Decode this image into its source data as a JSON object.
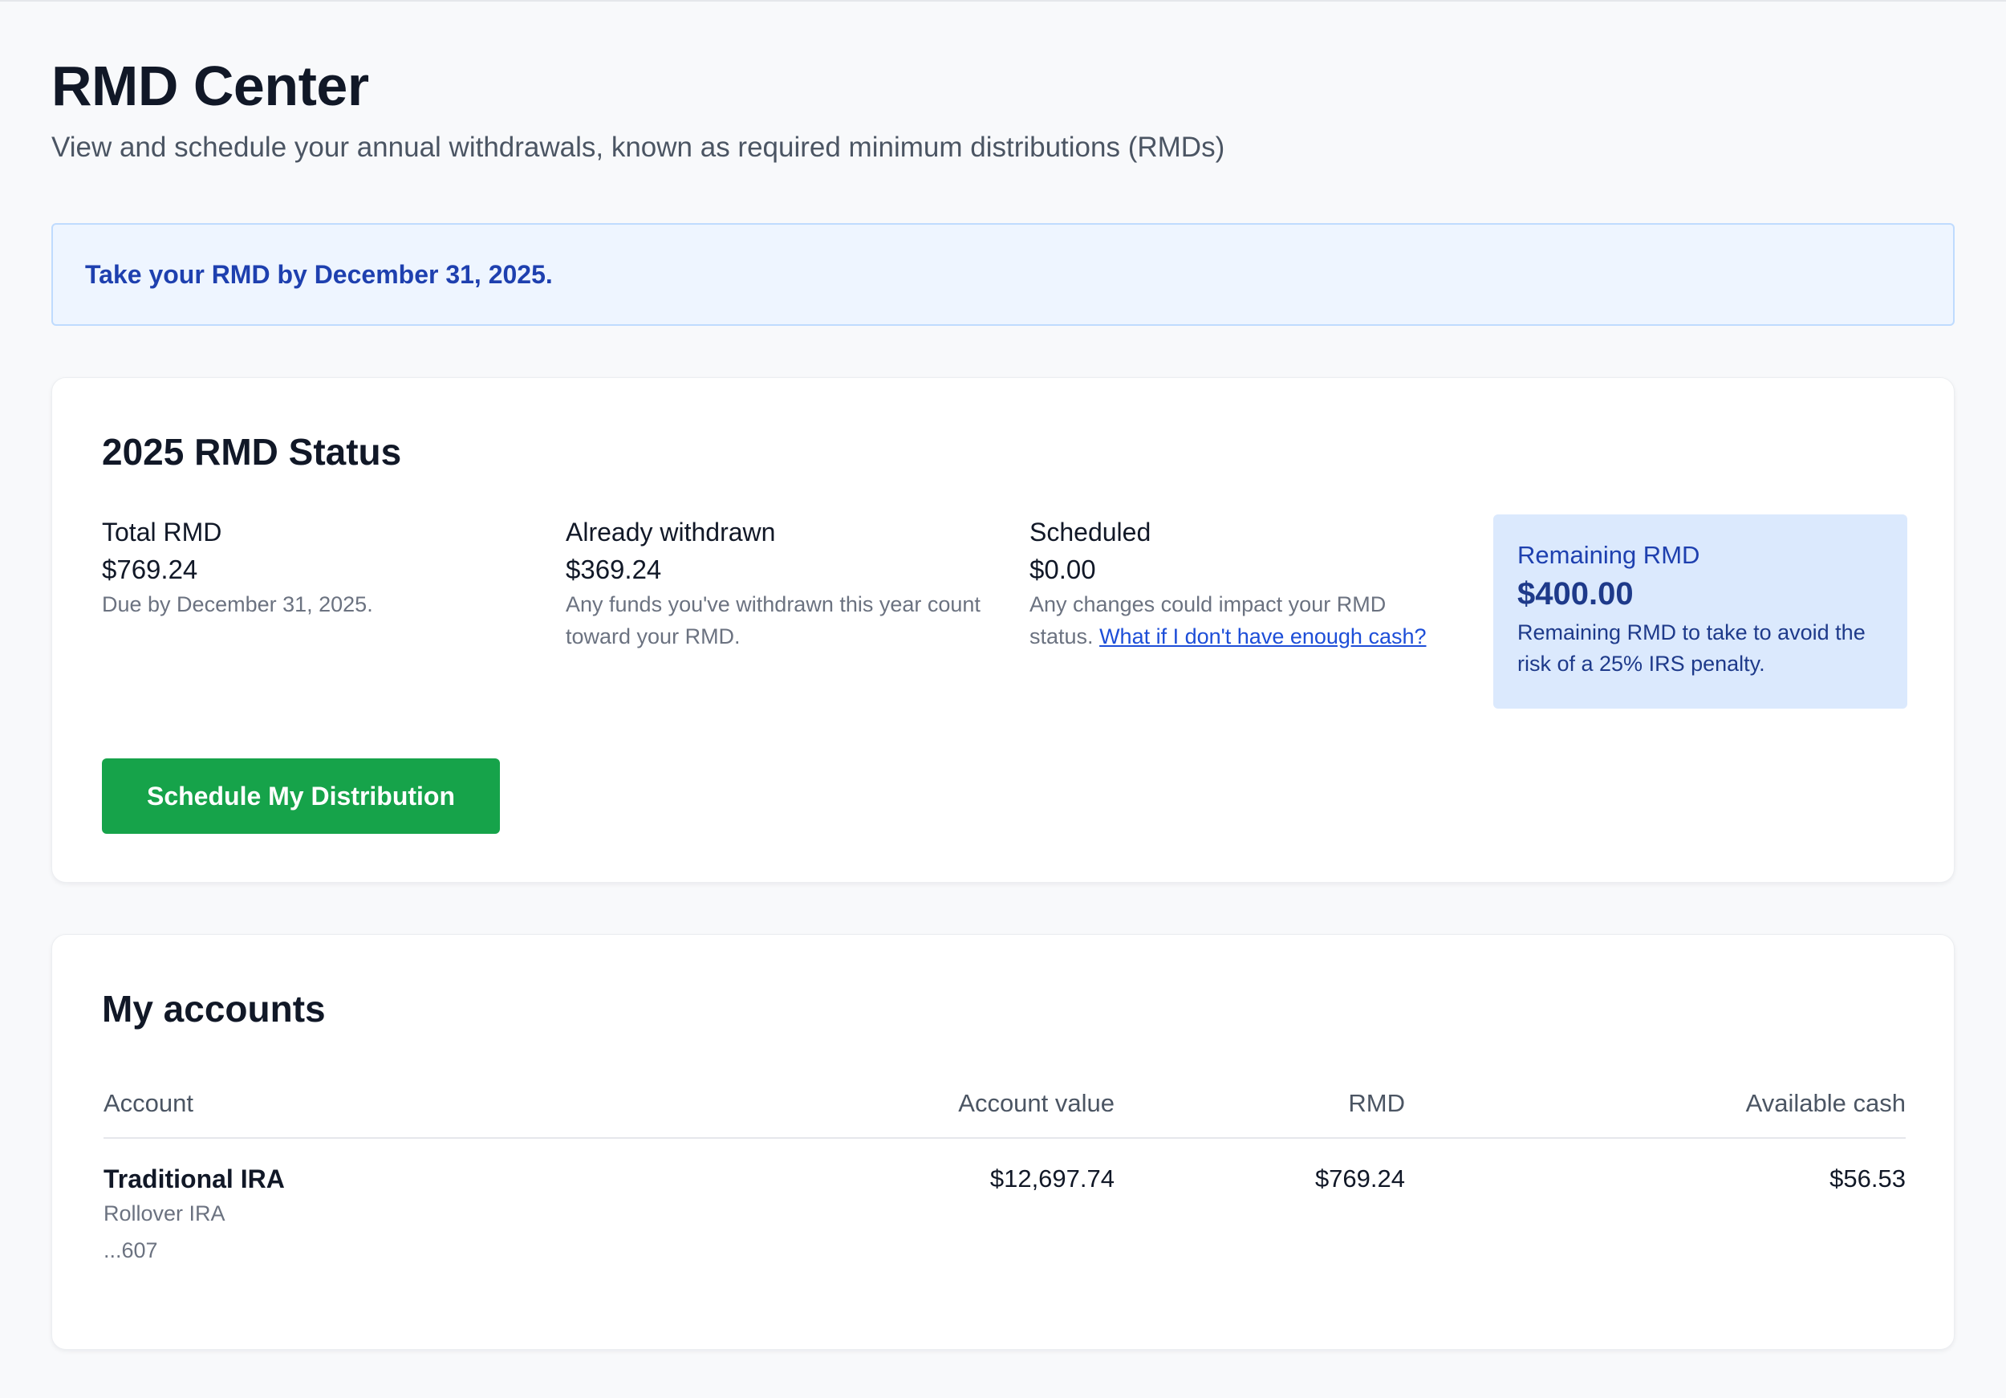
{
  "page": {
    "title": "RMD Center",
    "subtitle": "View and schedule your annual withdrawals, known as required minimum distributions (RMDs)"
  },
  "alert": {
    "text": "Take your RMD by December 31, 2025."
  },
  "status": {
    "title": "2025 RMD Status",
    "total": {
      "label": "Total RMD",
      "value": "$769.24",
      "note": "Due by December 31, 2025."
    },
    "withdrawn": {
      "label": "Already withdrawn",
      "value": "$369.24",
      "note": "Any funds you've withdrawn this year count toward your RMD."
    },
    "scheduled": {
      "label": "Scheduled",
      "value": "$0.00",
      "note": "Any changes could impact your RMD status.",
      "link": "What if I don't have enough cash?"
    },
    "remaining": {
      "label": "Remaining RMD",
      "value": "$400.00",
      "note": "Remaining RMD to take to avoid the risk of a 25% IRS penalty."
    },
    "schedule_button": "Schedule My Distribution"
  },
  "accounts": {
    "title": "My accounts",
    "columns": {
      "account": "Account",
      "value": "Account value",
      "rmd": "RMD",
      "cash": "Available cash"
    },
    "rows": [
      {
        "name": "Traditional IRA",
        "type": "Rollover IRA",
        "number": "...607",
        "value": "$12,697.74",
        "rmd": "$769.24",
        "cash": "$56.53"
      }
    ]
  },
  "colors": {
    "accent_green": "#16a34a",
    "alert_text": "#1e40af",
    "alert_bg": "#eef5ff",
    "remaining_bg": "#dbe9fd",
    "link": "#1d4ed8"
  }
}
